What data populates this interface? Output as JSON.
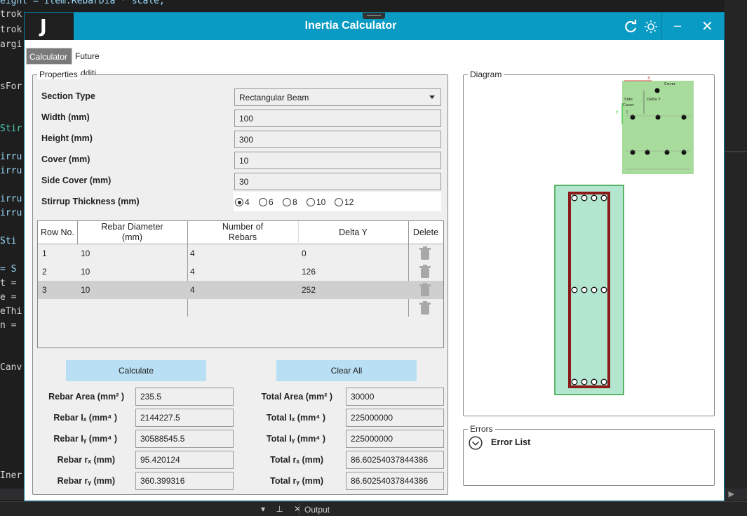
{
  "editor": {
    "top_line": "eight = item.RebarDia * scale,",
    "lines": [
      "trok",
      "trok",
      "argi",
      "sFor",
      "Stir",
      "irru",
      "irru",
      "irru",
      "irru",
      "Sti",
      "= S",
      "t =",
      "e =",
      "eThi",
      "n =",
      "Canv",
      "Iner"
    ],
    "output_label": "Output",
    "panel_controls": "▾ ⊥ ✕"
  },
  "window": {
    "logo": "J",
    "title": "Inertia Calculator",
    "refresh_icon": "refresh-icon",
    "theme_icon": "sun-icon",
    "minimize": "–",
    "close": "✕"
  },
  "tabs": [
    {
      "label": "Calculator",
      "active": true
    },
    {
      "label": "Future Additi",
      "active": false
    }
  ],
  "properties": {
    "group_label": "Properties",
    "section_type_label": "Section Type",
    "section_type_value": "Rectangular Beam",
    "width_label": "Width (mm)",
    "width_value": "100",
    "height_label": "Height (mm)",
    "height_value": "300",
    "cover_label": "Cover (mm)",
    "cover_value": "10",
    "side_cover_label": "Side Cover (mm)",
    "side_cover_value": "30",
    "stirrup_label": "Stirrup Thickness (mm)",
    "stirrup_options": [
      "4",
      "6",
      "8",
      "10",
      "12"
    ],
    "stirrup_selected": "4"
  },
  "table": {
    "headers": {
      "row_no": "Row No.",
      "rebar_dia_1": "Rebar Diameter",
      "rebar_dia_2": "(mm)",
      "num_1": "Number of",
      "num_2": "Rebars",
      "delta_y": "Delta Y",
      "delete": "Delete"
    },
    "rows": [
      {
        "row": "1",
        "dia": "10",
        "count": "4",
        "delta": "0"
      },
      {
        "row": "2",
        "dia": "10",
        "count": "4",
        "delta": "126"
      },
      {
        "row": "3",
        "dia": "10",
        "count": "4",
        "delta": "252"
      }
    ]
  },
  "buttons": {
    "calculate": "Calculate",
    "clear_all": "Clear All"
  },
  "results": {
    "rebar_area_label": "Rebar Area (mm² )",
    "rebar_area": "235.5",
    "rebar_ix_label": "Rebar Iₓ (mm⁴ )",
    "rebar_ix": "2144227.5",
    "rebar_iy_label": "Rebar Iᵧ (mm⁴ )",
    "rebar_iy": "30588545.5",
    "rebar_rx_label": "Rebar rₓ (mm)",
    "rebar_rx": "95.420124",
    "rebar_ry_label": "Rebar rᵧ (mm)",
    "rebar_ry": "360.399316",
    "total_area_label": "Total Area (mm² )",
    "total_area": "30000",
    "total_ix_label": "Total Iₓ (mm⁴ )",
    "total_ix": "225000000",
    "total_iy_label": "Total Iᵧ (mm⁴ )",
    "total_iy": "225000000",
    "total_rx_label": "Total rₓ (mm)",
    "total_rx": "86.60254037844386",
    "total_ry_label": "Total rᵧ (mm)",
    "total_ry": "86.60254037844386"
  },
  "diagram": {
    "group_label": "Diagram",
    "legend_cover": "Cover",
    "legend_side": "Side",
    "legend_cover2": "Cover",
    "legend_delta": "Delta Y",
    "legend_x": "X",
    "legend_y": "Y",
    "beam_fill": "#b3e6cf",
    "stirrup_color": "#8b1a1a",
    "outer_green": "#2e9e3e"
  },
  "errors": {
    "group_label": "Errors",
    "list_title": "Error List"
  }
}
